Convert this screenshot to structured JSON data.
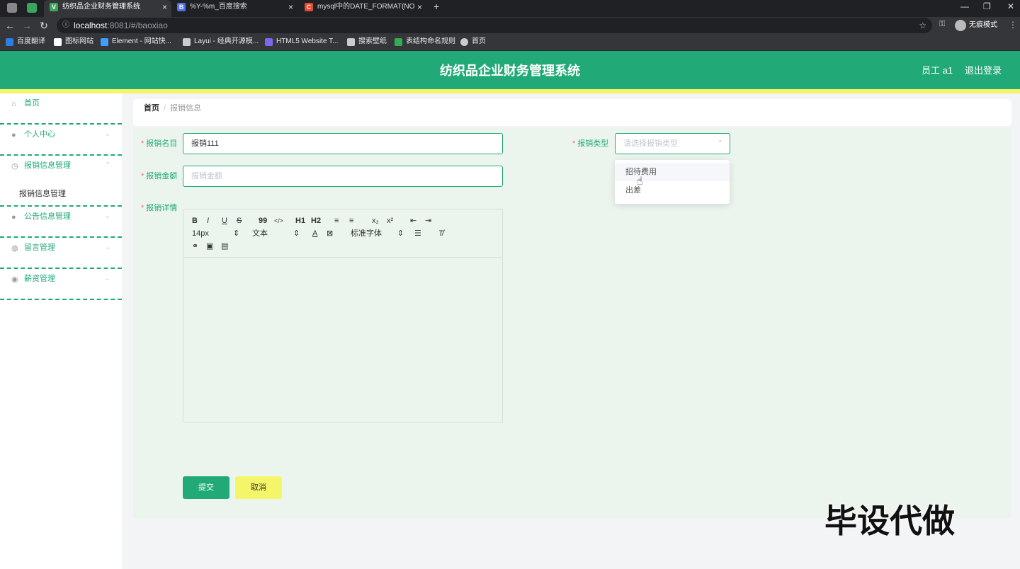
{
  "browser": {
    "tabs": [
      {
        "title": "纺织品企业财务管理系统",
        "favicon_color": "#3aa55c"
      },
      {
        "title": "%Y-%m_百度搜索",
        "favicon_color": "#4e6ef2"
      },
      {
        "title": "mysql中的DATE_FORMAT(NO",
        "favicon_color": "#e8482f"
      }
    ],
    "new_tab_label": "+",
    "url_host": "localhost",
    "url_path": ":8081/#/baoxiao",
    "incognito_label": "无痕模式",
    "bookmarks": [
      {
        "label": "百度翻译",
        "color": "#2a7fe0"
      },
      {
        "label": "图标网站",
        "color": "#ffffff"
      },
      {
        "label": "Element - 网站快...",
        "color": "#409eff"
      },
      {
        "label": "Layui - 经典开源模...",
        "color": "#cccccc"
      },
      {
        "label": "HTML5 Website T...",
        "color": "#7b68ee"
      },
      {
        "label": "搜索壁纸",
        "color": "#cccccc"
      },
      {
        "label": "表结构命名规则",
        "color": "#2eaf54"
      },
      {
        "label": "首页",
        "color": "#cccccc"
      }
    ]
  },
  "header": {
    "title": "纺织品企业财务管理系统",
    "user": "员工 a1",
    "logout": "退出登录"
  },
  "sidebar": {
    "items": [
      {
        "label": "首页",
        "icon": "home-icon"
      },
      {
        "label": "个人中心",
        "icon": "user-icon"
      },
      {
        "label": "报销信息管理",
        "icon": "clock-icon",
        "submenu": [
          "报销信息管理"
        ]
      },
      {
        "label": "公告信息管理",
        "icon": "user-icon"
      },
      {
        "label": "留言管理",
        "icon": "globe-icon"
      },
      {
        "label": "薪资管理",
        "icon": "location-icon"
      }
    ]
  },
  "breadcrumb": {
    "home": "首页",
    "separator": "/",
    "current": "报销信息"
  },
  "form": {
    "name_label": "报销名目",
    "name_value": "报销111",
    "type_label": "报销类型",
    "type_placeholder": "请选择报销类型",
    "type_options": [
      "招待费用",
      "出差"
    ],
    "amount_label": "报销金额",
    "amount_placeholder": "报销金额",
    "detail_label": "报销详情",
    "submit": "提交",
    "cancel": "取消"
  },
  "editor": {
    "toolbar_row1": [
      "B",
      "I",
      "U",
      "S",
      "99",
      "</>",
      "H1",
      "H2",
      "≡",
      "≡",
      "x₂",
      "x²",
      "⇤",
      "⇥"
    ],
    "font_size": "14px",
    "heading": "文本",
    "font_family": "标准字体"
  },
  "watermark": "毕设代做",
  "colors": {
    "primary": "#21aa78",
    "accent": "#f5f569",
    "panel": "#ecf4ee"
  }
}
